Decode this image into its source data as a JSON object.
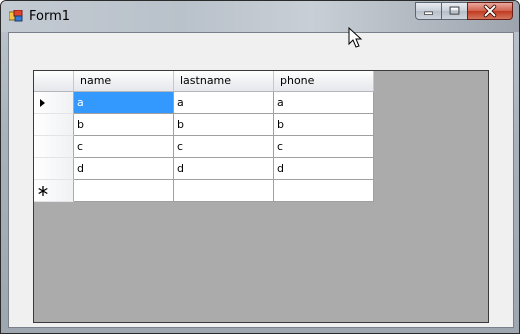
{
  "window": {
    "title": "Form1"
  },
  "grid": {
    "columns": [
      "name",
      "lastname",
      "phone"
    ],
    "rows": [
      [
        "a",
        "a",
        "a"
      ],
      [
        "b",
        "b",
        "b"
      ],
      [
        "c",
        "c",
        "c"
      ],
      [
        "d",
        "d",
        "d"
      ]
    ],
    "new_row": [
      "",
      "",
      ""
    ],
    "current_row_marker": "arrow-right-icon",
    "new_row_marker": "asterisk-icon",
    "selected_color": "#3399ff"
  }
}
